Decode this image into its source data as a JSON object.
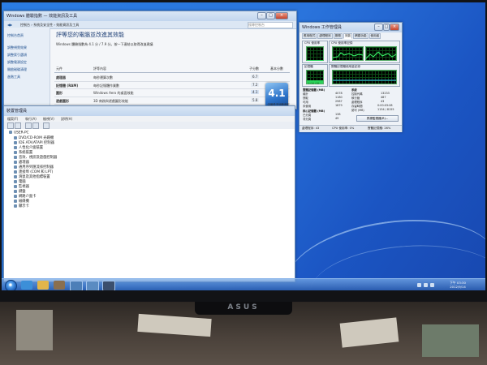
{
  "wei_window": {
    "title": "Windows 體驗指數 — 效能資訊及工具",
    "address": "控制台 › 系統及安全性 › 效能資訊及工具",
    "search_placeholder": "搜尋控制台",
    "heading": "評等您的電腦並改進其效能",
    "description": "Windows 體驗指數為 4.1 分 / 7.9 分。按一下連結以取得改進建議",
    "nav_items": [
      "控制台首頁",
      "調整視覺效果",
      "調整索引選項",
      "調整電源設定",
      "開啟磁碟清理",
      "進階工具"
    ],
    "table_headers": [
      "元件",
      "評等內容",
      "子分數",
      "基本分數"
    ],
    "rows": [
      {
        "component": "處理器",
        "desc": "每秒運算次數",
        "score": "6.7"
      },
      {
        "component": "記憶體 (RAM)",
        "desc": "每秒記憶體作業數",
        "score": "7.2"
      },
      {
        "component": "圖形",
        "desc": "Windows Aero 的桌面效能",
        "score": "4.1"
      },
      {
        "component": "遊戲圖形",
        "desc": "3D 商務與遊戲圖形效能",
        "score": "5.8"
      },
      {
        "component": "主要硬碟",
        "desc": "磁碟資料傳輸速率",
        "score": "5.9"
      }
    ],
    "base_score": "4.1",
    "base_caption": "由最低子分數決定"
  },
  "device_manager": {
    "title": "裝置管理員",
    "menu": [
      "檔案(F)",
      "執行(A)",
      "檢視(V)",
      "說明(H)"
    ],
    "tree": [
      "USER-PC",
      "DVD/CD-ROM 光碟機",
      "IDE ATA/ATAPI 控制器",
      "人性化介面裝置",
      "系統裝置",
      "音效、視訊及遊戲控制器",
      "處理器",
      "通用序列匯流排控制器",
      "連接埠 (COM 和 LPT)",
      "滑鼠及其他指標裝置",
      "電腦",
      "監視器",
      "鍵盤",
      "網路介面卡",
      "磁碟機",
      "顯示卡"
    ]
  },
  "task_manager": {
    "title": "Windows 工作管理員",
    "tabs": [
      "應用程式",
      "處理程序",
      "服務",
      "效能",
      "網路功能",
      "使用者"
    ],
    "active_tab": "效能",
    "cpu_usage_label": "CPU 使用率",
    "cpu_history_label": "CPU 使用率記錄",
    "cpu_percent": 0,
    "memory_label": "記憶體",
    "memory_history_label": "實體記憶體使用量記錄",
    "memory_value": "1.06 GB",
    "memory_fraction": 0.26,
    "physical_memory": {
      "title": "實體記憶體 (MB)",
      "labels": [
        "總計",
        "快取",
        "可用",
        "未使用"
      ],
      "values": [
        "4078",
        "1180",
        "2987",
        "1879"
      ]
    },
    "system": {
      "title": "系統",
      "labels": [
        "控制代碼",
        "執行緒",
        "處理程序",
        "存留時間",
        "認可 (MB)"
      ],
      "values": [
        "13233",
        "487",
        "43",
        "0:00:03:08",
        "1154 / 8155"
      ]
    },
    "kernel_memory": {
      "title": "核心記憶體 (MB)",
      "labels": [
        "已分頁",
        "非分頁"
      ],
      "values": [
        "138",
        "49"
      ]
    },
    "resource_button": "資源監視器(R)...",
    "status": {
      "processes": "處理程序: 43",
      "cpu": "CPU 使用率: 0%",
      "memory": "實體記憶體: 26%"
    }
  },
  "taskbar": {
    "time": "下午 03:30",
    "date": "2012/9/14"
  },
  "monitor_brand": "ASUS"
}
